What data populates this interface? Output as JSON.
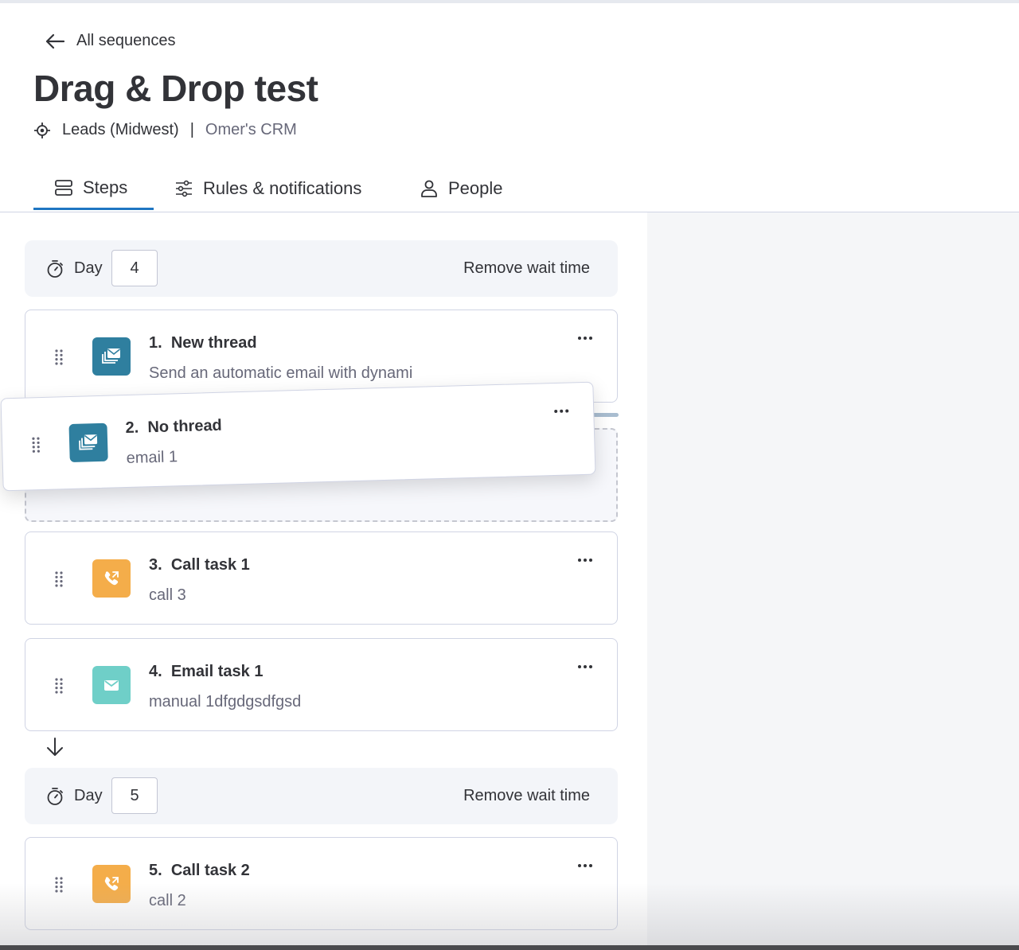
{
  "header": {
    "back_label": "All sequences",
    "title": "Drag & Drop test",
    "list_name": "Leads (Midwest)",
    "separator": "|",
    "crm_name": "Omer's CRM"
  },
  "tabs": [
    {
      "label": "Steps",
      "icon": "rows-icon",
      "active": true
    },
    {
      "label": "Rules & notifications",
      "icon": "sliders-icon",
      "active": false
    },
    {
      "label": "People",
      "icon": "person-icon",
      "active": false
    }
  ],
  "day_groups": [
    {
      "day_label": "Day",
      "day_value": "4",
      "remove_label": "Remove wait time"
    },
    {
      "day_label": "Day",
      "day_value": "5",
      "remove_label": "Remove wait time"
    }
  ],
  "steps": [
    {
      "number": "1.",
      "title": "New thread",
      "subtitle": "Send an automatic email with dynami",
      "type": "auto-email",
      "badge_color": "#2f7f9f"
    },
    {
      "number": "2.",
      "title": "No thread",
      "subtitle": "email 1",
      "type": "auto-email",
      "badge_color": "#2f7f9f",
      "state": "dragging"
    },
    {
      "number": "3.",
      "title": "Call task 1",
      "subtitle": "call 3",
      "type": "call",
      "badge_color": "#f4ad4a"
    },
    {
      "number": "4.",
      "title": "Email task 1",
      "subtitle": "manual 1dfgdgsdfgsd",
      "type": "manual-email",
      "badge_color": "#6fcfc8"
    },
    {
      "number": "5.",
      "title": "Call task 2",
      "subtitle": "call 2",
      "type": "call",
      "badge_color": "#f4ad4a"
    }
  ],
  "colors": {
    "accent": "#1f76c2",
    "auto_email_badge": "#2f7f9f",
    "call_badge": "#f4ad4a",
    "manual_email_badge": "#6fcfc8"
  }
}
